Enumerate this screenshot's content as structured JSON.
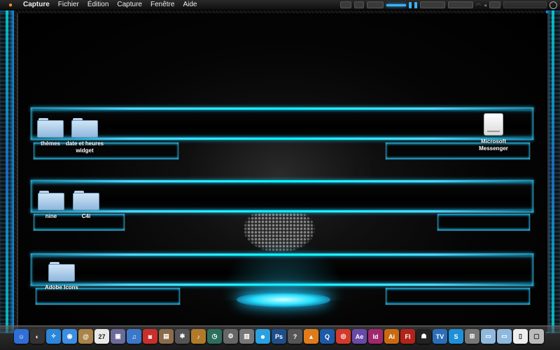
{
  "menubar": {
    "apple_icon": "apple-icon",
    "items": [
      "Capture",
      "Fichier",
      "Édition",
      "Capture",
      "Fenêtre",
      "Aide"
    ],
    "status_accent": "#39b4ff"
  },
  "desktop": {
    "icons": [
      {
        "label": "thèmes",
        "type": "folder"
      },
      {
        "label": "date et heures widget",
        "type": "folder"
      },
      {
        "label": "Microsoft Messenger",
        "type": "drive"
      },
      {
        "label": "nine",
        "type": "folder"
      },
      {
        "label": "C4i",
        "type": "folder"
      },
      {
        "label": "Adobe Icons",
        "type": "folder"
      }
    ],
    "accent": "#1ec8ff"
  },
  "dock": {
    "items": [
      {
        "name": "finder-icon",
        "color": "#2f6fd6",
        "glyph": "☺"
      },
      {
        "name": "dashboard-icon",
        "color": "#333",
        "glyph": "◐"
      },
      {
        "name": "safari-icon",
        "color": "#2b87d9",
        "glyph": "✧"
      },
      {
        "name": "ichat-icon",
        "color": "#3b8ee3",
        "glyph": "◉"
      },
      {
        "name": "address-book-icon",
        "color": "#a9834a",
        "glyph": "@"
      },
      {
        "name": "ical-icon",
        "color": "#e9e9e9",
        "glyph": "27"
      },
      {
        "name": "preview-icon",
        "color": "#6b6b9b",
        "glyph": "▣"
      },
      {
        "name": "itunes-icon",
        "color": "#3b78c9",
        "glyph": "♫"
      },
      {
        "name": "photo-booth-icon",
        "color": "#c9302c",
        "glyph": "◙"
      },
      {
        "name": "iphoto-icon",
        "color": "#8a6b4a",
        "glyph": "▤"
      },
      {
        "name": "automator-icon",
        "color": "#555",
        "glyph": "✱"
      },
      {
        "name": "garageband-icon",
        "color": "#b07a2a",
        "glyph": "♪"
      },
      {
        "name": "time-machine-icon",
        "color": "#2d6f5f",
        "glyph": "◷"
      },
      {
        "name": "system-preferences-icon",
        "color": "#666",
        "glyph": "⚙"
      },
      {
        "name": "toolbox-icon",
        "color": "#777",
        "glyph": "▥"
      },
      {
        "name": "messenger-icon",
        "color": "#2aa0e0",
        "glyph": "☻"
      },
      {
        "name": "photoshop-icon",
        "color": "#1f4f8a",
        "glyph": "Ps"
      },
      {
        "name": "help-icon",
        "color": "#555",
        "glyph": "?"
      },
      {
        "name": "vlc-icon",
        "color": "#e07b1a",
        "glyph": "▲"
      },
      {
        "name": "quicktime-icon",
        "color": "#1d5aa8",
        "glyph": "Q"
      },
      {
        "name": "chrome-icon",
        "color": "#d43a2c",
        "glyph": "◎"
      },
      {
        "name": "after-effects-icon",
        "color": "#6a4aa8",
        "glyph": "Ae"
      },
      {
        "name": "indesign-icon",
        "color": "#a0286e",
        "glyph": "Id"
      },
      {
        "name": "illustrator-icon",
        "color": "#c96a10",
        "glyph": "Ai"
      },
      {
        "name": "flash-icon",
        "color": "#b2241a",
        "glyph": "Fl"
      },
      {
        "name": "ninja-icon",
        "color": "#222",
        "glyph": "☗"
      },
      {
        "name": "tv-icon",
        "color": "#2a6fb8",
        "glyph": "TV"
      },
      {
        "name": "skype-icon",
        "color": "#1e90d8",
        "glyph": "S"
      },
      {
        "name": "calculator-icon",
        "color": "#777",
        "glyph": "⊞"
      },
      {
        "name": "applications-folder-icon",
        "color": "#8fb8dd",
        "glyph": "▭"
      },
      {
        "name": "documents-folder-icon",
        "color": "#8fb8dd",
        "glyph": "▭"
      },
      {
        "name": "document-icon",
        "color": "#eee",
        "glyph": "▯"
      },
      {
        "name": "trash-icon",
        "color": "#bbb",
        "glyph": "▢"
      }
    ]
  }
}
